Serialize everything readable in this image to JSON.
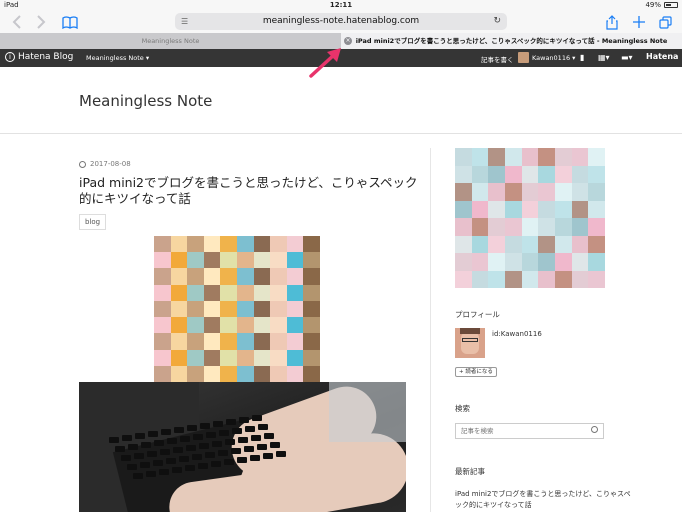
{
  "status_bar": {
    "device": "iPad",
    "time": "12:11",
    "battery": "49%",
    "battery_level": 0.49
  },
  "browser": {
    "url": "meaningless-note.hatenablog.com",
    "tabs": [
      {
        "title": "Meaningless Note"
      },
      {
        "title": "iPad mini2でブログを書こうと思ったけど、こりゃスペック的にキツイなって話 - Meaningless Note"
      }
    ]
  },
  "hatena_bar": {
    "logo": "Hatena Blog",
    "blog_select": "Meaningless Note ▾",
    "write": "記事を書く",
    "user": "Kawan0116 ▾",
    "brand": "Hatena"
  },
  "blog": {
    "title": "Meaningless Note"
  },
  "article": {
    "date": "2017-08-08",
    "title": "iPad mini2でブログを書こうと思ったけど、こりゃスペック的にキツイなって話",
    "tag": "blog"
  },
  "sidebar": {
    "profile_heading": "プロフィール",
    "user_id": "id:Kawan0116",
    "follow_label": "読者になる",
    "search_heading": "検索",
    "search_placeholder": "記事を検索",
    "recent_heading": "最新記事",
    "recent_item": "iPad mini2でブログを書こうと思ったけど、こりゃスペック的にキツイなって話"
  },
  "colors": {
    "accent": "#1a7ef5",
    "hatena_bar": "#353535",
    "annotation_arrow": "#e8336b",
    "mosaic_main": [
      "#f3ccd3",
      "#f7d6a0",
      "#e1e1a8",
      "#efc9b5",
      "#caa38c",
      "#a07b60",
      "#8a6a52",
      "#b3956e",
      "#9fc9c5",
      "#7dbfd0",
      "#4ebcd6",
      "#f2a93a",
      "#f0b34b",
      "#f8dcc4",
      "#f7c6ce",
      "#ffe9bf",
      "#e5e5c9",
      "#8a6848",
      "#c8a27c",
      "#e3b58c"
    ],
    "mosaic_side": [
      "#b8d7dc",
      "#9fc5cd",
      "#c5dbe0",
      "#cfe2e6",
      "#e3ccd4",
      "#eac6d2",
      "#f0b8cc",
      "#c49182",
      "#b29386",
      "#d1e8ec",
      "#e0f2f4",
      "#bfe3e9",
      "#a8d8df",
      "#f3d0da",
      "#e8c0cc",
      "#dfe6e8"
    ]
  }
}
